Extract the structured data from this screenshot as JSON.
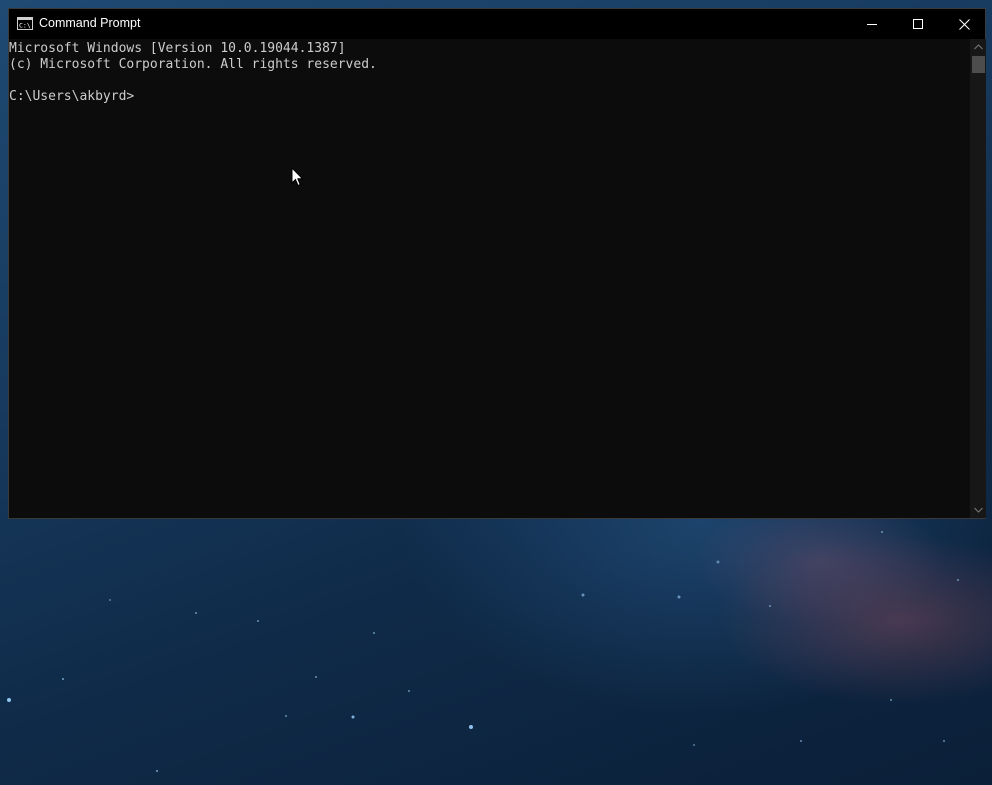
{
  "window": {
    "title": "Command Prompt",
    "icon": "cmd-icon",
    "controls": {
      "minimize": "minimize-icon",
      "maximize": "maximize-icon",
      "close": "close-icon"
    }
  },
  "console": {
    "lines": [
      "Microsoft Windows [Version 10.0.19044.1387]",
      "(c) Microsoft Corporation. All rights reserved.",
      "",
      "C:\\Users\\akbyrd>"
    ]
  },
  "colors": {
    "console_background": "#0c0c0c",
    "console_text": "#cccccc",
    "titlebar": "#000000"
  }
}
